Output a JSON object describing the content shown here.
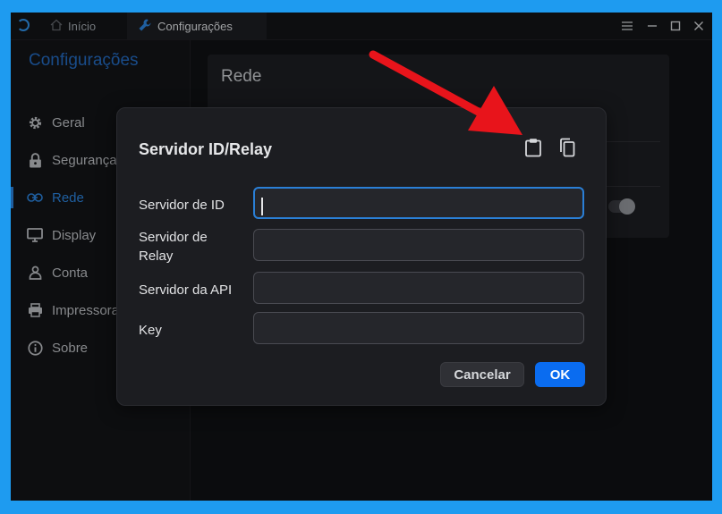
{
  "titlebar": {
    "tabs": [
      {
        "label": "Início",
        "icon": "home-icon"
      },
      {
        "label": "Configurações",
        "icon": "wrench-icon"
      }
    ],
    "controls": [
      "menu-icon",
      "minimize-icon",
      "maximize-icon",
      "close-icon"
    ]
  },
  "sidebar": {
    "title": "Configurações",
    "items": [
      {
        "label": "Geral",
        "icon": "gear-icon"
      },
      {
        "label": "Segurança",
        "icon": "lock-icon"
      },
      {
        "label": "Rede",
        "icon": "link-icon",
        "active": true
      },
      {
        "label": "Display",
        "icon": "monitor-icon"
      },
      {
        "label": "Conta",
        "icon": "user-icon"
      },
      {
        "label": "Impressora",
        "icon": "printer-icon"
      },
      {
        "label": "Sobre",
        "icon": "info-icon"
      }
    ]
  },
  "panel": {
    "title": "Rede"
  },
  "dialog": {
    "title": "Servidor ID/Relay",
    "icons": [
      "paste-icon",
      "copy-icon"
    ],
    "fields": [
      {
        "label": "Servidor de ID",
        "value": "",
        "focused": true
      },
      {
        "label": "Servidor de Relay",
        "value": ""
      },
      {
        "label": "Servidor da API",
        "value": ""
      },
      {
        "label": "Key",
        "value": ""
      }
    ],
    "cancel_label": "Cancelar",
    "ok_label": "OK"
  },
  "colors": {
    "frame": "#1e9bf0",
    "accent": "#2a7fd6",
    "ok_button": "#0a6cf0",
    "annotation_arrow": "#e8141b"
  }
}
